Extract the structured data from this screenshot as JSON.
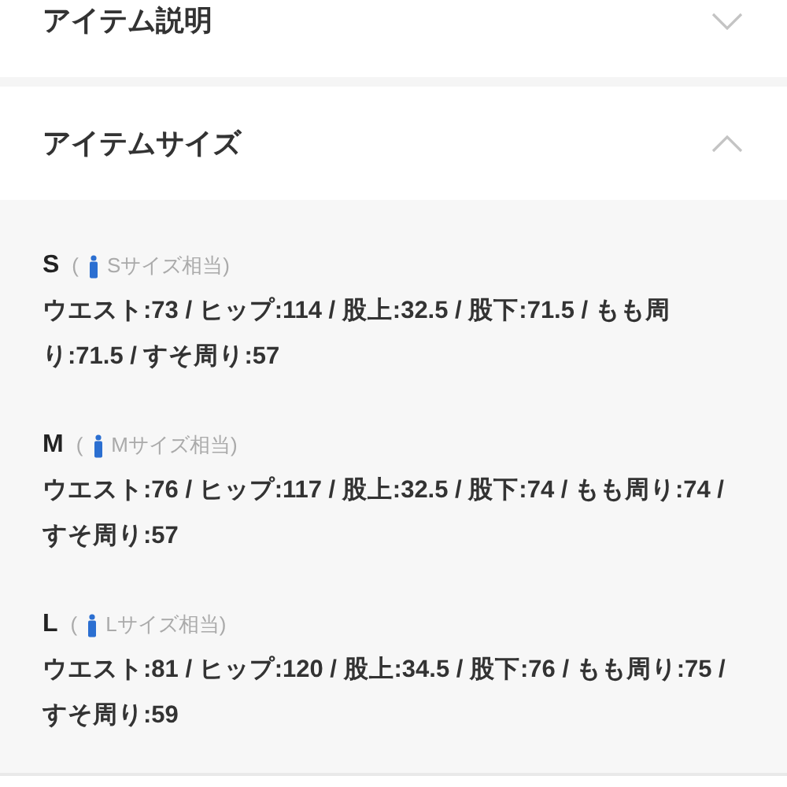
{
  "sections": [
    {
      "title": "アイテム説明",
      "expanded": false
    },
    {
      "title": "アイテムサイズ",
      "expanded": true
    }
  ],
  "sizes": [
    {
      "label": "S",
      "paren_open": "(",
      "note": "Sサイズ相当)",
      "measurements": "ウエスト:73 / ヒップ:114 / 股上:32.5 / 股下:71.5 / もも周り:71.5 / すそ周り:57"
    },
    {
      "label": "M",
      "paren_open": "(",
      "note": "Mサイズ相当)",
      "measurements": "ウエスト:76 / ヒップ:117 / 股上:32.5 / 股下:74 / もも周り:74 / すそ周り:57"
    },
    {
      "label": "L",
      "paren_open": "(",
      "note": "Lサイズ相当)",
      "measurements": "ウエスト:81 / ヒップ:120 / 股上:34.5 / 股下:76 / もも周り:75 / すそ周り:59"
    }
  ]
}
